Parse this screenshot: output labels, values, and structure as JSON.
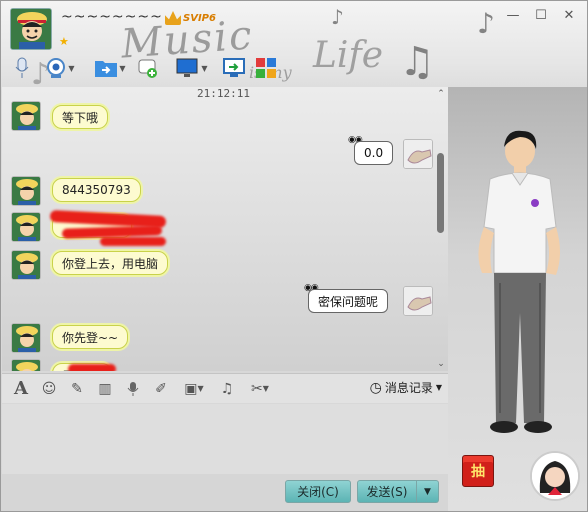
{
  "header": {
    "nickname": "~~~~~~~~",
    "vip_label": "SVIP6",
    "star": "★",
    "decor_text": "Music",
    "decor_text2": "is my",
    "decor_text3": "Life"
  },
  "window_controls": {
    "minimize": "—",
    "maximize": "☐",
    "close": "✕"
  },
  "chat": {
    "time": "21:12:11",
    "messages": [
      {
        "side": "left",
        "text": "等下哦"
      },
      {
        "side": "right",
        "text": "0.0"
      },
      {
        "side": "left",
        "text": "844350793"
      },
      {
        "side": "left",
        "text": ""
      },
      {
        "side": "left",
        "text": "你登上去，用电脑"
      },
      {
        "side": "right",
        "text": "密保问题呢"
      },
      {
        "side": "left",
        "text": "你先登~~"
      },
      {
        "side": "left",
        "text": "用"
      }
    ]
  },
  "input_toolbar": {
    "history_label": "消息记录"
  },
  "buttons": {
    "close_label": "关闭(C)",
    "send_label": "发送(S)"
  },
  "right_panel": {
    "gift_label": "抽"
  },
  "colors": {
    "bubble_yellow": "#fdfbd0",
    "button_teal": "#5cb4b4",
    "redaction": "#e8201a"
  }
}
